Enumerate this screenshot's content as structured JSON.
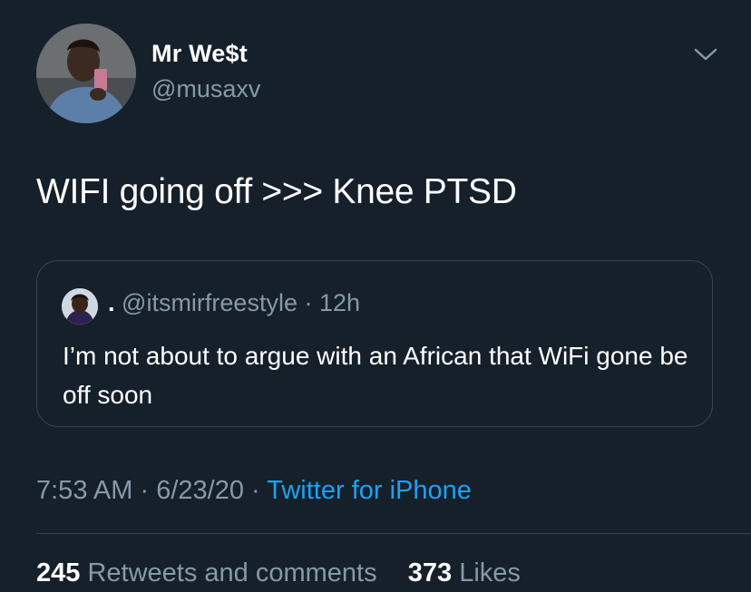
{
  "author": {
    "display_name": "Mr We$t",
    "handle": "@musaxv"
  },
  "tweet": {
    "text": "WIFI going off >>> Knee PTSD"
  },
  "quoted": {
    "display_name": ".",
    "handle": "@itsmirfreestyle",
    "separator": "·",
    "time": "12h",
    "text": "I’m not about to argue with an African that WiFi gone be off soon"
  },
  "meta": {
    "time": "7:53 AM",
    "sep1": "·",
    "date": "6/23/20",
    "sep2": "·",
    "source": "Twitter for iPhone"
  },
  "stats": {
    "retweets_count": "245",
    "retweets_label": "Retweets and comments",
    "likes_count": "373",
    "likes_label": "Likes"
  },
  "colors": {
    "background": "#15202b",
    "primary_text": "#ffffff",
    "secondary_text": "#8899a6",
    "accent": "#1da1f2",
    "border": "#38444d"
  },
  "icons": {
    "caret": "chevron-down-icon"
  }
}
